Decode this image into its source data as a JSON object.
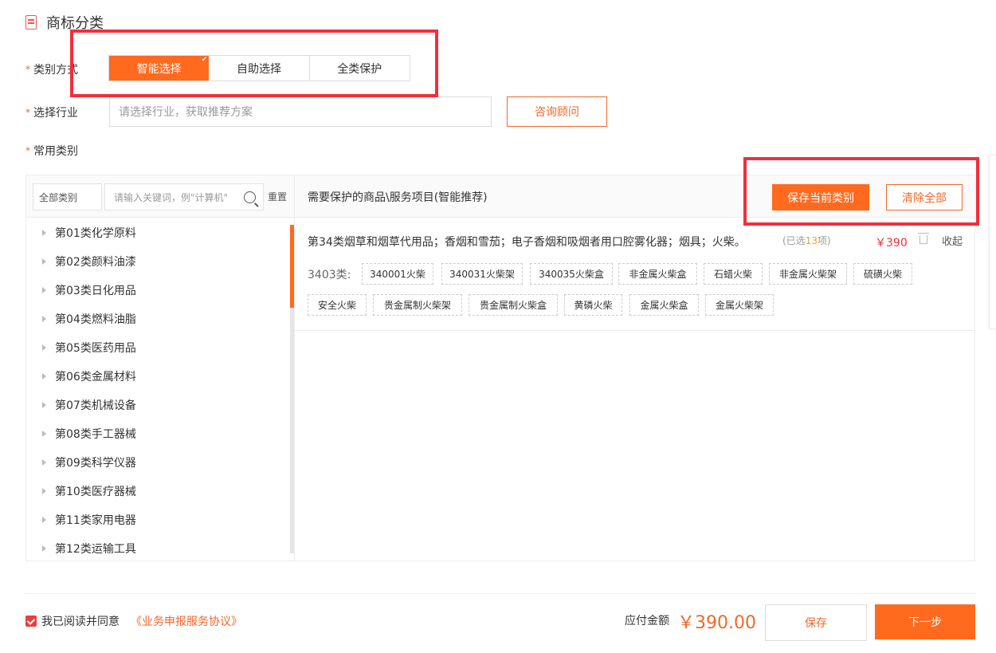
{
  "section": {
    "title": "商标分类"
  },
  "form": {
    "category_method_label": "类别方式",
    "industry_label": "选择行业",
    "common_label": "常用类别",
    "required_mark": "*",
    "method_options": [
      "智能选择",
      "自助选择",
      "全类保护"
    ],
    "selected_method": "智能选择",
    "industry_placeholder": "请选择行业，获取推荐方案",
    "consult_button": "咨询顾问"
  },
  "left_panel": {
    "category_select": "全部类别",
    "keyword_placeholder": "请输入关键词，例\"计算机\"",
    "reset": "重置",
    "categories": [
      "第01类化学原料",
      "第02类颜料油漆",
      "第03类日化用品",
      "第04类燃料油脂",
      "第05类医药用品",
      "第06类金属材料",
      "第07类机械设备",
      "第08类手工器械",
      "第09类科学仪器",
      "第10类医疗器械",
      "第11类家用电器",
      "第12类运输工具"
    ],
    "scroll_fraction_visible": 0.25
  },
  "right_panel": {
    "header_title": "需要保护的商品\\服务项目(智能推荐)",
    "save_current": "保存当前类别",
    "clear_all": "清除全部",
    "class_block": {
      "title": "第34类烟草和烟草代用品；香烟和雪茄；电子香烟和吸烟者用口腔雾化器；烟具；火柴。",
      "selected_prefix": "(已选",
      "selected_count": "13",
      "selected_suffix": "项)",
      "price": "￥390",
      "collapse": "收起",
      "subclass_label": "3403类:",
      "tags": [
        "340001火柴",
        "340031火柴架",
        "340035火柴盒",
        "非金属火柴盒",
        "石蜡火柴",
        "非金属火柴架",
        "硫磺火柴",
        "安全火柴",
        "贵金属制火柴架",
        "贵金属制火柴盒",
        "黄磷火柴",
        "金属火柴盒",
        "金属火柴架"
      ]
    }
  },
  "footer": {
    "agree_text": "我已阅读并同意",
    "agreement_link": "《业务申报服务协议》",
    "agreed": true,
    "payable_label": "应付金额",
    "payable_amount": "￥390.00",
    "save": "保存",
    "next": "下一步"
  },
  "colors": {
    "accent": "#ff6a1f",
    "highlight_box": "#f22f3b",
    "price": "#f22f3b"
  }
}
